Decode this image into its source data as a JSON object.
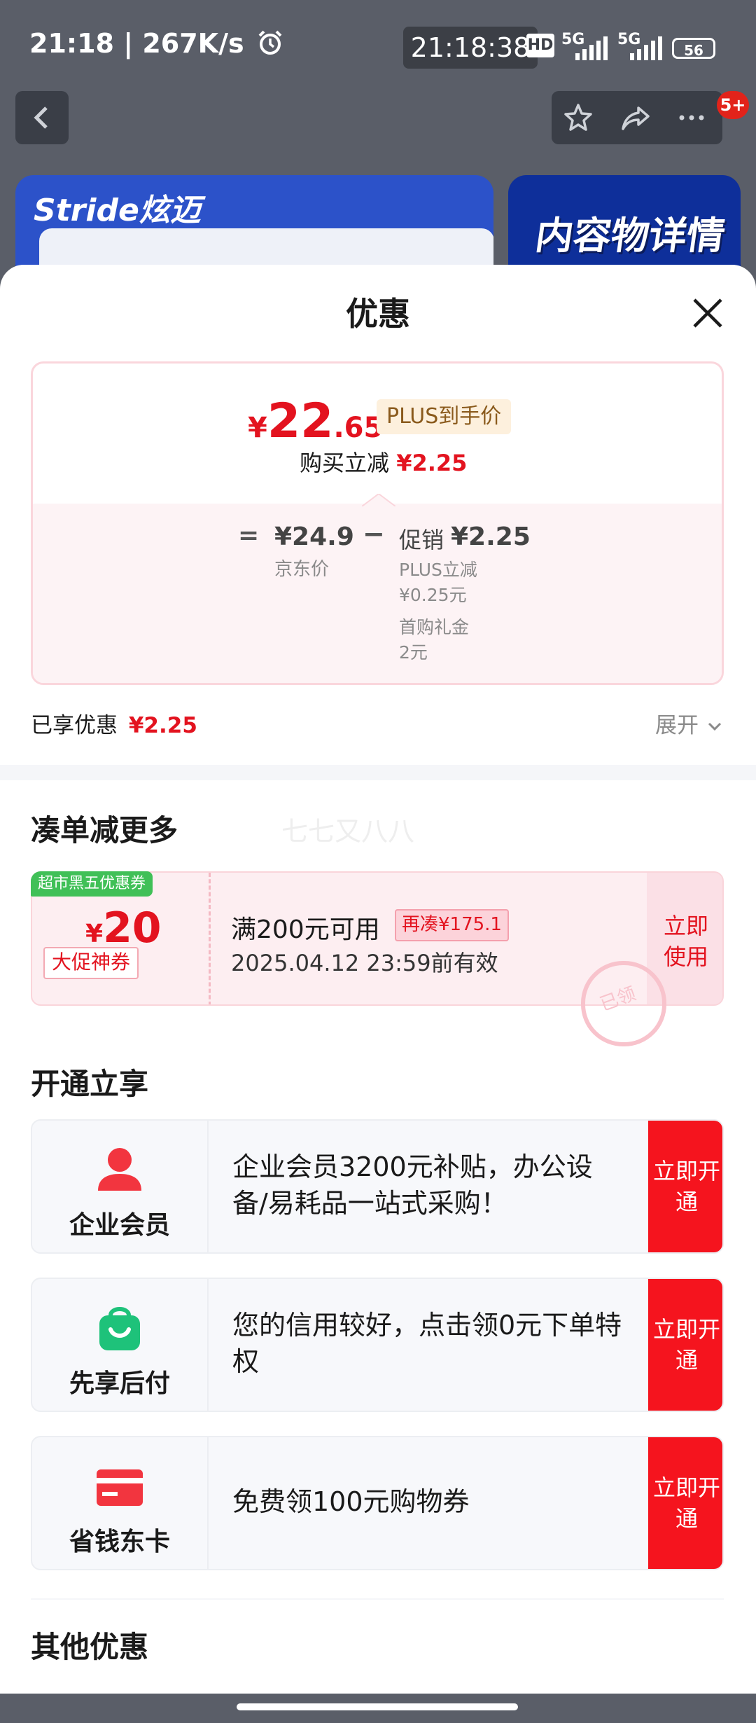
{
  "status": {
    "time": "21:18",
    "net_speed": "267K/s",
    "alarm_icon": "alarm-icon",
    "clock": "21:18:38",
    "hd": "HD",
    "sig1": "5G",
    "sig2": "5G",
    "battery": "56"
  },
  "header": {
    "badge": "5+",
    "banner_left_text": "Stride炫迈",
    "banner_right_text": "内容物详情"
  },
  "sheet": {
    "title": "优惠",
    "price": {
      "symbol": "¥",
      "main": "22",
      "decimal": ".65",
      "tag": "PLUS到手价",
      "instant_label": "购买立减",
      "instant_value": "¥2.25",
      "eq": "=",
      "jd_price": "¥24.9",
      "jd_label": "京东价",
      "minus": "−",
      "promo_label": "促销",
      "promo_value": "¥2.25",
      "plus_cut_label": "PLUS立减",
      "plus_cut_value": "¥0.25元",
      "first_gift_label": "首购礼金",
      "first_gift_value": "2元"
    },
    "enjoyed_label": "已享优惠",
    "enjoyed_value": "¥2.25",
    "expand_label": "展开",
    "combine": {
      "title": "凑单减更多",
      "watermark": "七七又八八",
      "coupon": {
        "tag": "超市黑五优惠券",
        "symbol": "¥",
        "amount": "20",
        "ticket": "大促神券",
        "condition": "满200元可用",
        "refill": "再凑¥175.1",
        "expire": "2025.04.12 23:59前有效",
        "action": "立即使用",
        "stamp": "已领"
      }
    },
    "open": {
      "title": "开通立享",
      "items": [
        {
          "name": "企业会员",
          "desc": "企业会员3200元补贴，办公设备/易耗品一站式采购！",
          "action": "立即开通",
          "icon": "person-icon"
        },
        {
          "name": "先享后付",
          "desc": "您的信用较好，点击领0元下单特权",
          "action": "立即开通",
          "icon": "shopping-bag-icon"
        },
        {
          "name": "省钱东卡",
          "desc": "免费领100元购物券",
          "action": "立即开通",
          "icon": "card-icon"
        }
      ]
    },
    "other_title": "其他优惠"
  }
}
